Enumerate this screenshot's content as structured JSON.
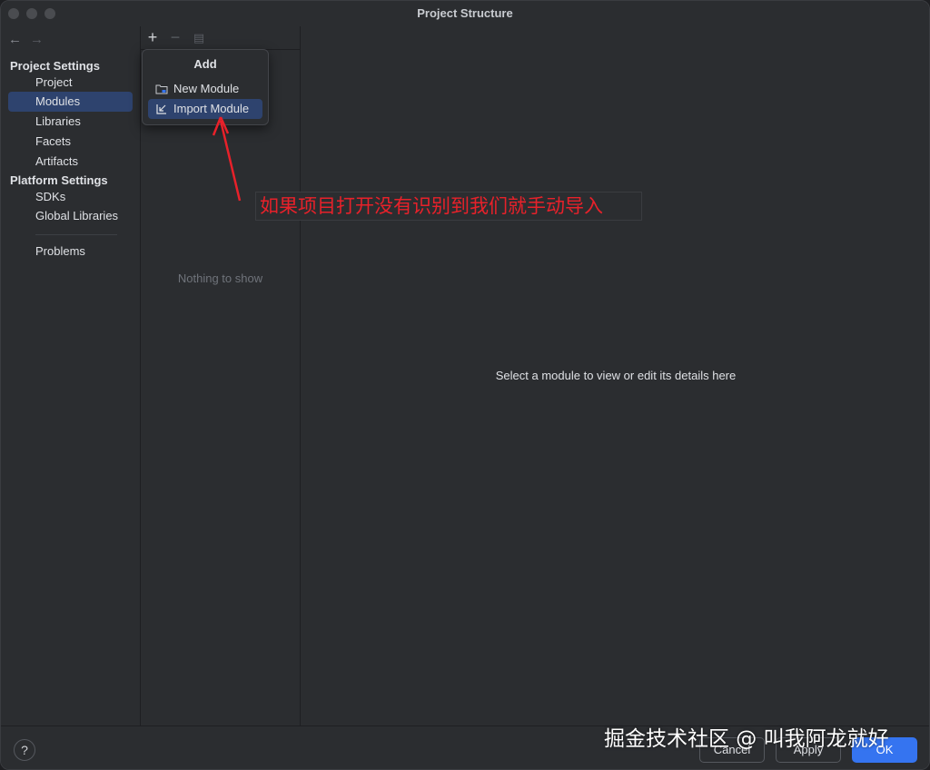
{
  "window": {
    "title": "Project Structure"
  },
  "sidebar": {
    "project_settings_header": "Project Settings",
    "project_items": [
      "Project",
      "Modules",
      "Libraries",
      "Facets",
      "Artifacts"
    ],
    "platform_settings_header": "Platform Settings",
    "platform_items": [
      "SDKs",
      "Global Libraries"
    ],
    "problems": "Problems",
    "selected": "Modules"
  },
  "module_pane": {
    "add_icon": "plus-icon",
    "remove_icon": "minus-icon",
    "copy_icon": "copy-icon",
    "empty_text": "Nothing to show"
  },
  "popup": {
    "title": "Add",
    "items": [
      "New Module",
      "Import Module"
    ],
    "selected": "Import Module"
  },
  "detail": {
    "hint": "Select a module to view or edit its details here"
  },
  "annotation": {
    "text": "如果项目打开没有识别到我们就手动导入",
    "color": "#e8212a"
  },
  "footer": {
    "help": "?",
    "cancel": "Cancel",
    "apply": "Apply",
    "ok": "OK"
  },
  "watermark": "掘金技术社区 @ 叫我阿龙就好",
  "colors": {
    "accent": "#3574f0",
    "selection": "#2e436e",
    "background": "#2b2d30"
  }
}
